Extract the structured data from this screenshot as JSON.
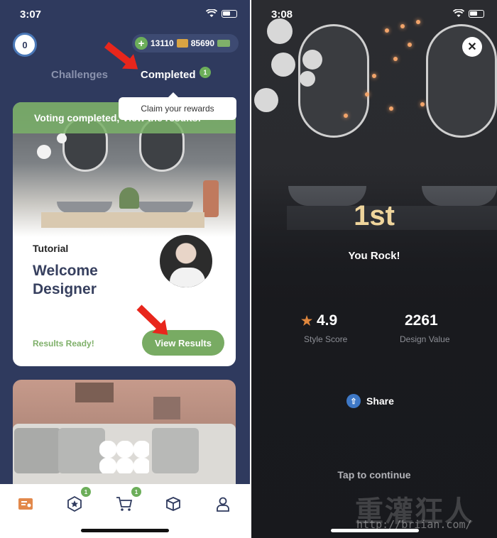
{
  "left": {
    "status": {
      "time": "3:07"
    },
    "level": "0",
    "currency": {
      "coins": "13110",
      "cash": "85690"
    },
    "tabs": {
      "challenges": "Challenges",
      "completed": "Completed",
      "completed_badge": "1"
    },
    "tooltip": "Claim your rewards",
    "card": {
      "banner": "Voting completed, View the results!",
      "tag": "Tutorial",
      "title": "Welcome Designer",
      "status": "Results Ready!",
      "button": "View Results"
    },
    "nav": {
      "items": [
        {
          "icon": "challenges-icon"
        },
        {
          "icon": "star-badge-icon",
          "badge": "1"
        },
        {
          "icon": "cart-icon",
          "badge": "1"
        },
        {
          "icon": "box-icon"
        },
        {
          "icon": "profile-icon"
        }
      ]
    }
  },
  "right": {
    "status": {
      "time": "3:08"
    },
    "rank": "1st",
    "message": "You Rock!",
    "stats": {
      "style_score": {
        "value": "4.9",
        "label": "Style Score"
      },
      "design_value": {
        "value": "2261",
        "label": "Design Value"
      }
    },
    "share": "Share",
    "tap": "Tap to continue"
  },
  "watermark": {
    "chinese": "重灌狂人",
    "url": "http://briian.com/"
  },
  "colors": {
    "accent_green": "#78ab63",
    "rank_gold": "#efd59c",
    "bg_navy": "#2f3a5e",
    "annotation_red": "#e8261c"
  }
}
